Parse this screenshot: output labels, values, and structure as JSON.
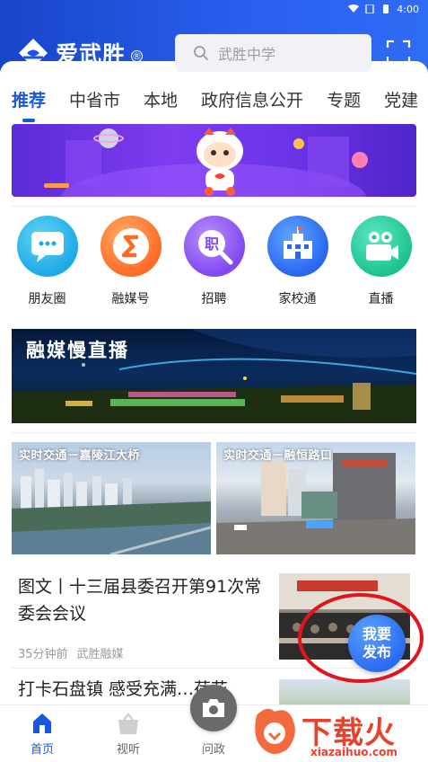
{
  "status_bar": {
    "time": "4:00"
  },
  "header": {
    "app_name": "爱武胜",
    "registered_mark": "®",
    "search_placeholder": "武胜中学",
    "brand_color": "#1f55e6"
  },
  "tabs": [
    {
      "label": "推荐",
      "active": true
    },
    {
      "label": "中省市",
      "active": false
    },
    {
      "label": "本地",
      "active": false
    },
    {
      "label": "政府信息公开",
      "active": false
    },
    {
      "label": "专题",
      "active": false
    },
    {
      "label": "党建",
      "active": false
    }
  ],
  "entries": [
    {
      "label": "朋友圈",
      "icon": "chat-bubble-icon"
    },
    {
      "label": "融媒号",
      "icon": "media-s-icon"
    },
    {
      "label": "招聘",
      "icon": "job-search-icon"
    },
    {
      "label": "家校通",
      "icon": "school-building-icon"
    },
    {
      "label": "直播",
      "icon": "camera-live-icon"
    }
  ],
  "live_banner": {
    "title": "融媒慢直播"
  },
  "cams": [
    {
      "title": "实时交通－嘉陵江大桥"
    },
    {
      "title": "实时交通－融恒路口"
    }
  ],
  "news": [
    {
      "title": "图文丨十三届县委召开第91次常委会会议",
      "time": "35分钟前",
      "source": "武胜融媒"
    },
    {
      "title": "打卡石盘镇 感受充满…荷花"
    }
  ],
  "publish": {
    "line1": "我要",
    "line2": "发布"
  },
  "bottom_nav": [
    {
      "label": "首页",
      "active": true
    },
    {
      "label": "视听",
      "active": false
    },
    {
      "label": "问政",
      "active": false
    }
  ],
  "watermark": {
    "text": "下载火",
    "url": "xiazaihuo.com"
  }
}
